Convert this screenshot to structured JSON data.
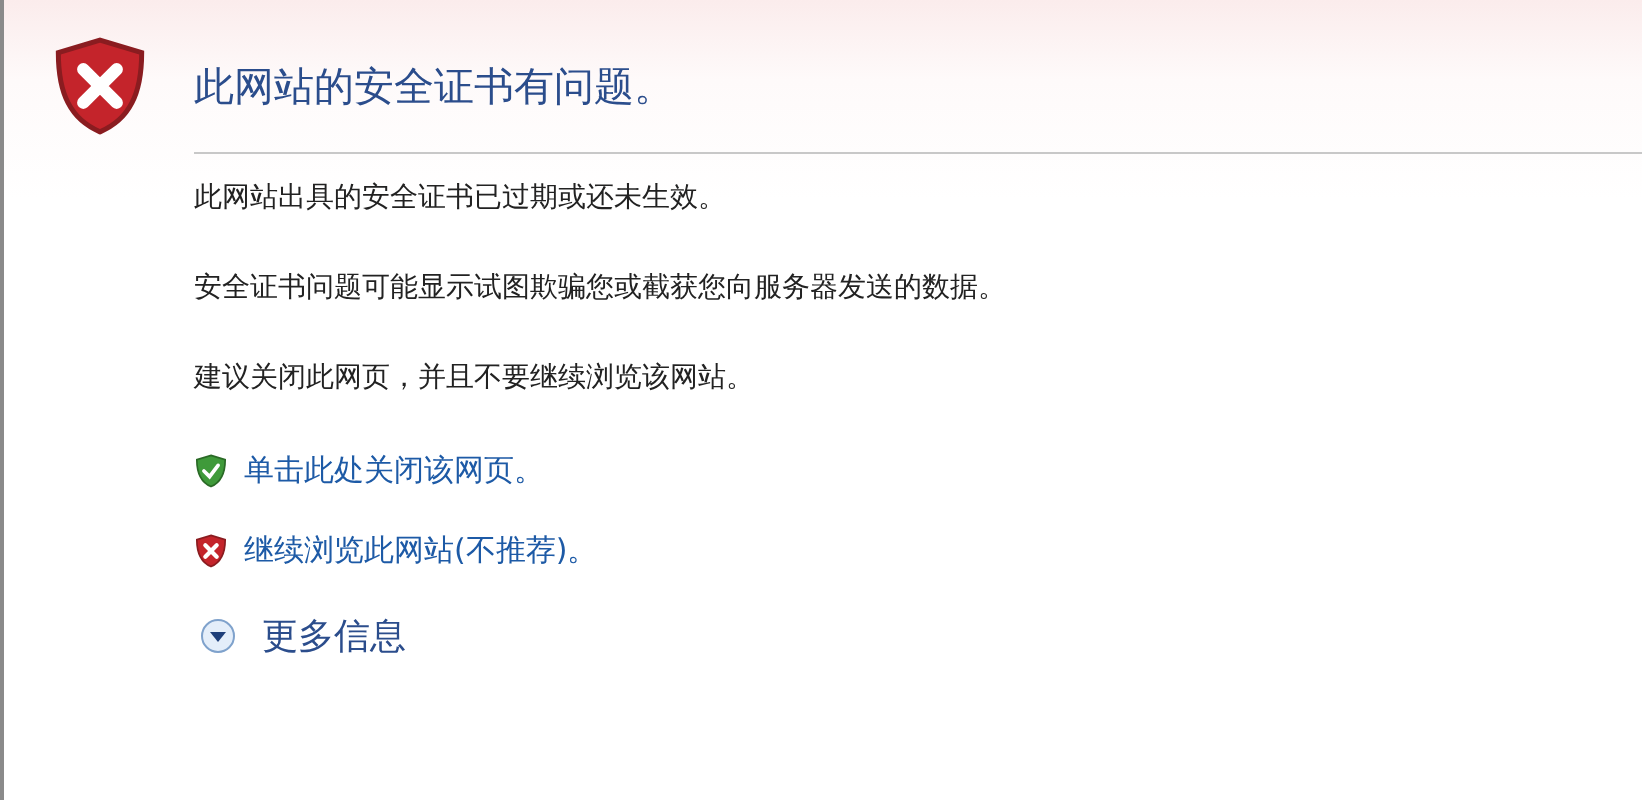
{
  "title": "此网站的安全证书有问题。",
  "paragraphs": [
    "此网站出具的安全证书已过期或还未生效。",
    "安全证书问题可能显示试图欺骗您或截获您向服务器发送的数据。",
    "建议关闭此网页，并且不要继续浏览该网站。"
  ],
  "links": [
    {
      "kind": "safe",
      "label": "单击此处关闭该网页。"
    },
    {
      "kind": "unsafe",
      "label": "继续浏览此网站(不推荐)。"
    }
  ],
  "more_info": {
    "label": "更多信息",
    "expanded": false
  }
}
